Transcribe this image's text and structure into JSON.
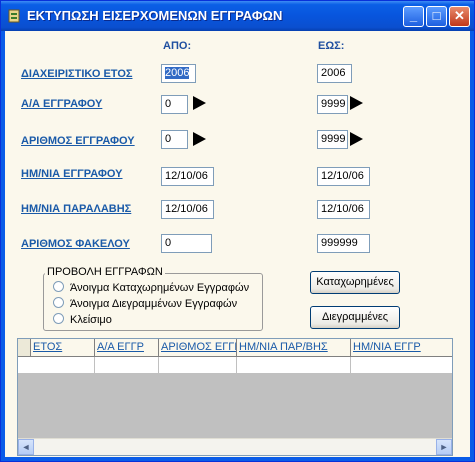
{
  "window": {
    "title": "ΕΚΤΥΠΩΣΗ ΕΙΣΕΡΧΟΜΕΝΩΝ ΕΓΓΡΑΦΩΝ",
    "minimize_label": "_",
    "maximize_label": "□",
    "close_label": "✕"
  },
  "columns": {
    "from_label": "ΑΠΟ:",
    "to_label": "ΕΩΣ:"
  },
  "rows": [
    {
      "label": "ΔΙΑΧΕΙΡΙΣΤΙΚΟ ΕΤΟΣ",
      "from": "2006",
      "to": "2006"
    },
    {
      "label": "Α/Α ΕΓΓΡΑΦΟΥ",
      "from": "0",
      "to": "9999"
    },
    {
      "label": "ΑΡΙΘΜΟΣ ΕΓΓΡΑΦΟΥ",
      "from": "0",
      "to": "9999"
    },
    {
      "label": "ΗΜ/ΝΙΑ ΕΓΓΡΑΦΟΥ",
      "from": "12/10/06",
      "to": "12/10/06"
    },
    {
      "label": "ΗΜ/ΝΙΑ ΠΑΡΑΛΑΒΗΣ",
      "from": "12/10/06",
      "to": "12/10/06"
    },
    {
      "label": "ΑΡΙΘΜΟΣ ΦΑΚΕΛΟΥ",
      "from": "0",
      "to": "999999"
    }
  ],
  "view_group": {
    "title": "ΠΡΟΒΟΛΗ ΕΓΓΡΑΦΩΝ",
    "options": [
      "Άνοιγμα Καταχωρημένων Εγγραφών",
      "Άνοιγμα Διεγραμμένων Εγγραφών",
      "Κλείσιμο"
    ]
  },
  "buttons": {
    "registered": "Καταχωρημένες",
    "deleted": "Διεγραμμένες"
  },
  "grid": {
    "headers": [
      "ΕΤΟΣ",
      "Α/Α ΕΓΓΡ",
      "ΑΡΙΘΜΟΣ ΕΓΓΡ",
      "ΗΜ/ΝΙΑ ΠΑΡ/ΒΗΣ",
      "ΗΜ/ΝΙΑ ΕΓΓΡ"
    ]
  },
  "scrollbar": {
    "left_arrow": "◄",
    "right_arrow": "►"
  },
  "icons": {
    "app": "app-icon",
    "spin_arrow": "arrow-right-icon"
  }
}
